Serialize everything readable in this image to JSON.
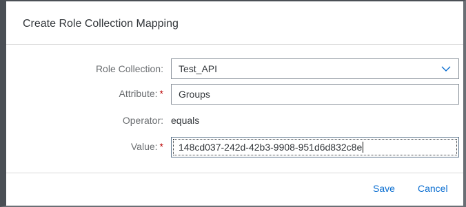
{
  "dialog": {
    "title": "Create Role Collection Mapping"
  },
  "form": {
    "role_collection": {
      "label": "Role Collection:",
      "value": "Test_API"
    },
    "attribute": {
      "label": "Attribute:",
      "required_marker": "*",
      "value": "Groups"
    },
    "operator": {
      "label": "Operator:",
      "value": "equals"
    },
    "value": {
      "label": "Value:",
      "required_marker": "*",
      "value": "148cd037-242d-42b3-9908-951d6d832c8e"
    }
  },
  "footer": {
    "save_label": "Save",
    "cancel_label": "Cancel"
  },
  "colors": {
    "accent": "#0a6ed1",
    "required": "#bb0000",
    "label": "#6a6d70",
    "text": "#32363a"
  },
  "icons": {
    "select_arrow": "chevron-down-icon"
  }
}
